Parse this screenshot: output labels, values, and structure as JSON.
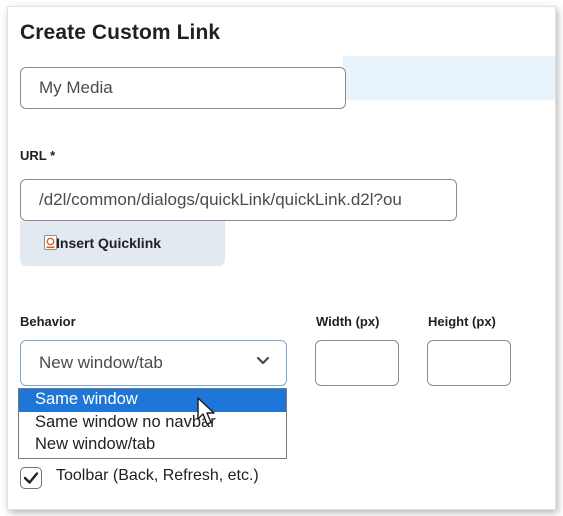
{
  "dialog": {
    "title": "Create Custom Link"
  },
  "name_field": {
    "value": "My Media"
  },
  "url_field": {
    "label": "URL *",
    "value": "/d2l/common/dialogs/quickLink/quickLink.d2l?ou"
  },
  "quicklink_button": {
    "label": "Insert Quicklink",
    "icon": "quicklink-icon"
  },
  "behavior": {
    "label": "Behavior",
    "selected": "New window/tab",
    "options": [
      "Same window",
      "Same window no navbar",
      "New window/tab"
    ],
    "highlighted": "Same window"
  },
  "width_field": {
    "label": "Width (px)",
    "value": ""
  },
  "height_field": {
    "label": "Height (px)",
    "value": ""
  },
  "toolbar_option": {
    "label": "Toolbar (Back, Refresh, etc.)",
    "checked": true
  },
  "colors": {
    "accent": "#1e77d8",
    "button_bg": "#e3e9f1",
    "highlight_band": "#e8f3fb"
  }
}
